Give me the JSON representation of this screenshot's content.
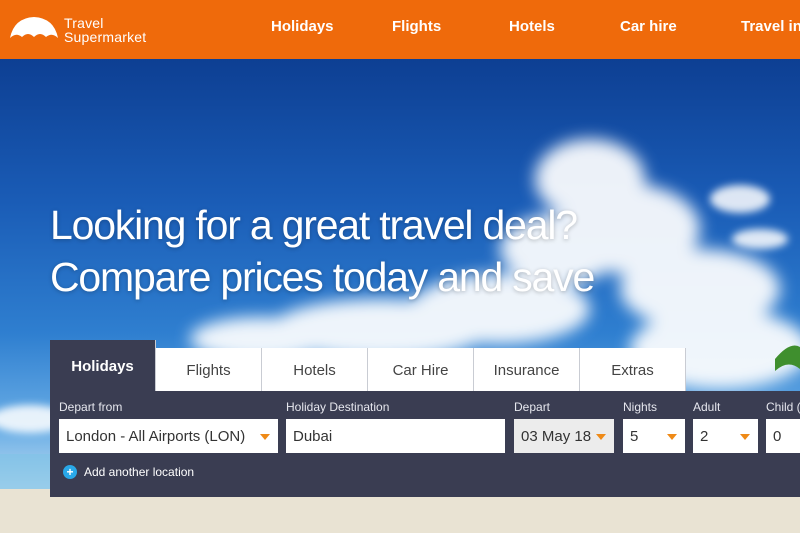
{
  "brand": {
    "line1": "Travel",
    "line2": "Supermarket",
    "color": "#ef6a0b"
  },
  "nav": [
    "Holidays",
    "Flights",
    "Hotels",
    "Car hire",
    "Travel ins"
  ],
  "hero": {
    "line1": "Looking for a great travel deal?",
    "line2": "Compare prices today and save"
  },
  "tabs": [
    "Holidays",
    "Flights",
    "Hotels",
    "Car Hire",
    "Insurance",
    "Extras"
  ],
  "search": {
    "depart_from": {
      "label": "Depart from",
      "value": "London - All Airports (LON)"
    },
    "destination": {
      "label": "Holiday Destination",
      "value": "Dubai"
    },
    "depart": {
      "label": "Depart",
      "value": "03 May 18"
    },
    "nights": {
      "label": "Nights",
      "value": "5"
    },
    "adult": {
      "label": "Adult",
      "value": "2"
    },
    "child": {
      "label": "Child (",
      "value": "0"
    },
    "add_location": "Add another location"
  }
}
